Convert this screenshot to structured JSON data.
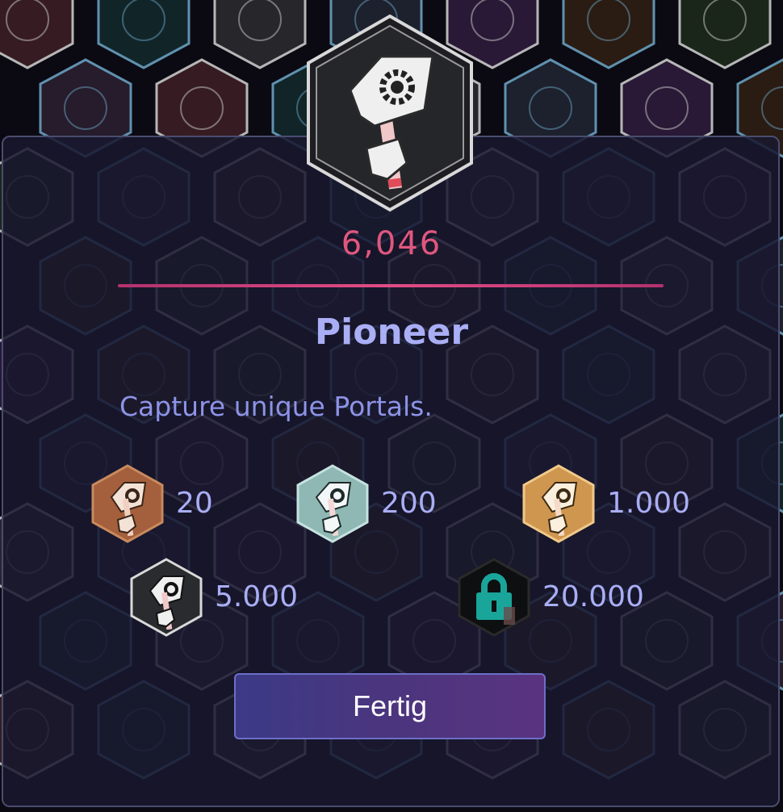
{
  "badge": {
    "count": "6,046",
    "name": "Pioneer",
    "description": "Capture unique Portals.",
    "icon": "pioneer-flag-icon"
  },
  "tiers": [
    {
      "level": "bronze",
      "value": "20",
      "color": "#b06a45"
    },
    {
      "level": "silver",
      "value": "200",
      "color": "#9fc7c4"
    },
    {
      "level": "gold",
      "value": "1.000",
      "color": "#d9a35a"
    },
    {
      "level": "platinum",
      "value": "5.000",
      "color": "#d6d6d6"
    },
    {
      "level": "onyx",
      "value": "20.000",
      "color": "#1aa59a",
      "locked": true
    }
  ],
  "actions": {
    "done_label": "Fertig"
  },
  "colors": {
    "accent": "#e0577e",
    "title": "#a9aef5",
    "panel": "#18172e"
  }
}
